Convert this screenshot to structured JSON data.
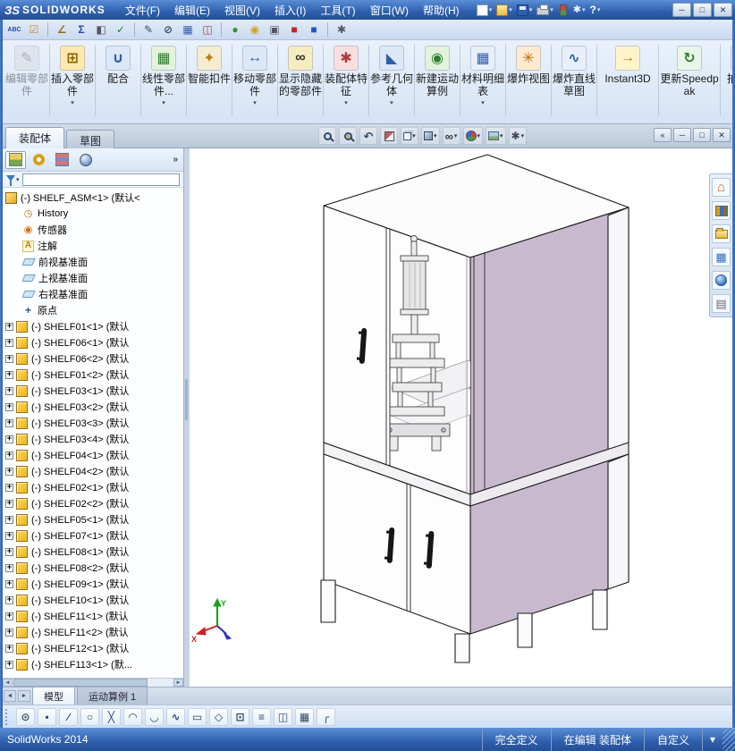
{
  "titlebar": {
    "logo_mark": "ЗS",
    "logo_text": "SOLIDWORKS",
    "menus": [
      "文件(F)",
      "编辑(E)",
      "视图(V)",
      "插入(I)",
      "工具(T)",
      "窗口(W)",
      "帮助(H)"
    ],
    "quick_access": [
      {
        "name": "new-document-button",
        "kind": "page",
        "arrow": true
      },
      {
        "name": "open-button",
        "kind": "folder",
        "arrow": true
      },
      {
        "name": "save-button",
        "kind": "disk",
        "arrow": true
      },
      {
        "name": "print-button",
        "kind": "printer",
        "arrow": true
      },
      {
        "name": "rebuild-button",
        "kind": "rebuild"
      },
      {
        "name": "options-button",
        "kind": "options",
        "arrow": true
      },
      {
        "name": "help-button",
        "kind": "help",
        "arrow": true
      }
    ],
    "window_buttons": [
      {
        "name": "minimize-button",
        "glyph": "─"
      },
      {
        "name": "maximize-button",
        "glyph": "□"
      },
      {
        "name": "close-button",
        "glyph": "✕"
      }
    ]
  },
  "toolbar2": {
    "items": [
      {
        "name": "spell-check-icon",
        "glyph": "ABC",
        "color": "#1f49b0"
      },
      {
        "name": "design-checker-icon",
        "glyph": "☑",
        "color": "#d88018"
      },
      {
        "name": "measure-icon",
        "glyph": "∠",
        "color": "#9a6a10",
        "sep": true
      },
      {
        "name": "mass-properties-icon",
        "glyph": "Σ",
        "color": "#1f49b0"
      },
      {
        "name": "section-properties-icon",
        "glyph": "◧",
        "color": "#555566"
      },
      {
        "name": "check-entity-icon",
        "glyph": "✓",
        "color": "#1a8a1a"
      },
      {
        "name": "sketch-entities-icon",
        "glyph": "✎",
        "color": "#334f6b",
        "sep": true
      },
      {
        "name": "dimension-icon",
        "glyph": "⊘",
        "color": "#334f6b"
      },
      {
        "name": "table-icon",
        "glyph": "▦",
        "color": "#2f5fae"
      },
      {
        "name": "interference-check-icon",
        "glyph": "◫",
        "color": "#b33a3a"
      },
      {
        "name": "appearance-swatch-icon",
        "glyph": "●",
        "color": "#2f8f2f",
        "sep": true
      },
      {
        "name": "lights-icon",
        "glyph": "◉",
        "color": "#d8a018"
      },
      {
        "name": "camera-icon",
        "glyph": "▣",
        "color": "#555566"
      },
      {
        "name": "red-swatch-icon",
        "glyph": "■",
        "color": "#cc2222"
      },
      {
        "name": "blue-swatch-icon",
        "glyph": "■",
        "color": "#2255cc"
      },
      {
        "name": "toolbar-options-icon",
        "glyph": "✱",
        "color": "#555566",
        "sep": true
      }
    ]
  },
  "ribbon": {
    "buttons": [
      {
        "name": "edit-component",
        "label": "编辑零部件",
        "glyph": "✎",
        "fg": "#777d86",
        "bg": "#d9dde3",
        "disabled": true
      },
      {
        "name": "insert-component",
        "label": "插入零部件",
        "glyph": "⊞",
        "fg": "#8a5c00",
        "bg": "#ffe9ae",
        "arrow": true
      },
      {
        "name": "mate",
        "label": "配合",
        "glyph": "∪",
        "fg": "#2f5fae",
        "bg": "#dce8f8"
      },
      {
        "name": "linear-component-pattern",
        "label": "线性零部件...",
        "glyph": "▦",
        "fg": "#2f7f2f",
        "bg": "#e2f2dc",
        "arrow": true
      },
      {
        "name": "smart-fasteners",
        "label": "智能扣件",
        "glyph": "✦",
        "fg": "#b8860b",
        "bg": "#f5ecd2"
      },
      {
        "name": "move-component",
        "label": "移动零部件",
        "glyph": "↔",
        "fg": "#2f5fae",
        "bg": "#dce8f8",
        "arrow": true
      },
      {
        "name": "show-hidden-components",
        "label": "显示隐藏的零部件",
        "glyph": "∞",
        "fg": "#333333",
        "bg": "#f7ecc0"
      },
      {
        "name": "assembly-features",
        "label": "装配体特征",
        "glyph": "✱",
        "fg": "#b03a3a",
        "bg": "#f8dfdf",
        "arrow": true
      },
      {
        "name": "reference-geometry",
        "label": "参考几何体",
        "glyph": "◣",
        "fg": "#2f5fae",
        "bg": "#dce8f8",
        "arrow": true
      },
      {
        "name": "new-motion-study",
        "label": "新建运动算例",
        "glyph": "◉",
        "fg": "#2f7f2f",
        "bg": "#e2f2dc"
      },
      {
        "name": "bill-of-materials",
        "label": "材料明细表",
        "glyph": "▦",
        "fg": "#2f5fae",
        "bg": "#e8eff8",
        "arrow": true
      },
      {
        "name": "exploded-view",
        "label": "爆炸视图",
        "glyph": "✳",
        "fg": "#c06a10",
        "bg": "#ffe9cf"
      },
      {
        "name": "explode-line-sketch",
        "label": "爆炸直线草图",
        "glyph": "∿",
        "fg": "#2f5fae",
        "bg": "#e8eff8"
      },
      {
        "name": "instant3d",
        "label": "Instant3D",
        "glyph": "→",
        "fg": "#c08a00",
        "bg": "#fff3cc",
        "wide": true
      },
      {
        "name": "update-speedpak",
        "label": "更新Speedpak",
        "glyph": "↻",
        "fg": "#2f7f2f",
        "bg": "#e8f5e8",
        "wide": true
      },
      {
        "name": "take-snapshot",
        "label": "拍快照",
        "glyph": "⊙",
        "fg": "#555555",
        "bg": "#e8e8ea"
      }
    ]
  },
  "command_tabs": [
    {
      "label": "装配体",
      "active": true
    },
    {
      "label": "草图",
      "active": false
    }
  ],
  "headsup": [
    {
      "name": "zoom-fit-icon",
      "kind": "mag"
    },
    {
      "name": "zoom-to-area-icon",
      "kind": "mag2"
    },
    {
      "name": "previous-view-icon",
      "kind": "undo"
    },
    {
      "name": "section-view-icon",
      "kind": "section"
    },
    {
      "name": "view-orientation-icon",
      "kind": "cube",
      "arrow": true
    },
    {
      "name": "display-style-icon",
      "kind": "shaded",
      "arrow": true
    },
    {
      "name": "hide-show-items-icon",
      "kind": "glasses",
      "arrow": true
    },
    {
      "name": "edit-appearance-icon",
      "kind": "ball",
      "arrow": true
    },
    {
      "name": "apply-scene-icon",
      "kind": "scene",
      "arrow": true
    },
    {
      "name": "view-settings-icon",
      "kind": "gear",
      "arrow": true
    }
  ],
  "doc_controls": [
    {
      "name": "dock-panel-button",
      "glyph": "«"
    },
    {
      "name": "minimize-document-button",
      "glyph": "─"
    },
    {
      "name": "restore-document-button",
      "glyph": "□"
    },
    {
      "name": "close-document-button",
      "glyph": "✕"
    }
  ],
  "feature_panel": {
    "manager_tabs": [
      {
        "name": "feature-manager-tab",
        "kind": "fm"
      },
      {
        "name": "property-manager-tab",
        "kind": "pm"
      },
      {
        "name": "configuration-manager-tab",
        "kind": "cm"
      },
      {
        "name": "display-manager-tab",
        "kind": "dm"
      }
    ],
    "expand_glyph": "»",
    "filter_arrow": "▾",
    "filter": {
      "value": ""
    },
    "scrollbar": {
      "left": "◄",
      "right": "►"
    },
    "tree": {
      "root": {
        "label": "(-) SHELF_ASM<1> (默认<"
      },
      "folders": [
        {
          "kind": "history",
          "label": "History"
        },
        {
          "kind": "sensor",
          "label": "传感器"
        },
        {
          "kind": "annotation",
          "label": "注解"
        },
        {
          "kind": "plane",
          "label": "前视基准面"
        },
        {
          "kind": "plane",
          "label": "上视基准面"
        },
        {
          "kind": "plane",
          "label": "右视基准面"
        },
        {
          "kind": "origin",
          "label": "原点"
        }
      ],
      "components": [
        "(-) SHELF01<1> (默认",
        "(-) SHELF06<1> (默认",
        "(-) SHELF06<2> (默认",
        "(-) SHELF01<2> (默认",
        "(-) SHELF03<1> (默认",
        "(-) SHELF03<2> (默认",
        "(-) SHELF03<3> (默认",
        "(-) SHELF03<4> (默认",
        "(-) SHELF04<1> (默认",
        "(-) SHELF04<2> (默认",
        "(-) SHELF02<1> (默认",
        "(-) SHELF02<2> (默认",
        "(-) SHELF05<1> (默认",
        "(-) SHELF07<1> (默认",
        "(-) SHELF08<1> (默认",
        "(-) SHELF08<2> (默认",
        "(-) SHELF09<1> (默认",
        "(-) SHELF10<1> (默认",
        "(-) SHELF11<1> (默认",
        "(-) SHELF11<2> (默认",
        "(-) SHELF12<1> (默认",
        "(-) SHELF113<1> (默..."
      ]
    }
  },
  "task_pane": [
    {
      "name": "task-pane-resources-tab",
      "kind": "home"
    },
    {
      "name": "design-library-tab",
      "kind": "books"
    },
    {
      "name": "file-explorer-tab",
      "kind": "folder"
    },
    {
      "name": "view-palette-tab",
      "kind": "palette"
    },
    {
      "name": "appearances-tab",
      "kind": "sphere"
    },
    {
      "name": "custom-properties-tab",
      "kind": "doc"
    }
  ],
  "doc_tabs": {
    "nav": [
      {
        "name": "tab-scroll-left-button",
        "glyph": "◄"
      },
      {
        "name": "tab-scroll-right-button",
        "glyph": "►"
      }
    ],
    "tabs": [
      {
        "label": "模型",
        "active": true
      },
      {
        "label": "运动算例 1",
        "active": false
      }
    ]
  },
  "sketch_toolbar": {
    "items": [
      {
        "name": "smart-dimension-icon",
        "glyph": "⊙"
      },
      {
        "name": "point-icon",
        "glyph": "•"
      },
      {
        "name": "line-icon",
        "glyph": "∕"
      },
      {
        "name": "circle-icon",
        "glyph": "○"
      },
      {
        "name": "trim-icon",
        "glyph": "╳"
      },
      {
        "name": "arc-icon",
        "glyph": "◠"
      },
      {
        "name": "tangent-arc-icon",
        "glyph": "◡"
      },
      {
        "name": "spline-icon",
        "glyph": "∿"
      },
      {
        "name": "rectangle-icon",
        "glyph": "▭"
      },
      {
        "name": "polygon-icon",
        "glyph": "◇"
      },
      {
        "name": "convert-entities-icon",
        "glyph": "⊡"
      },
      {
        "name": "offset-entities-icon",
        "glyph": "≡"
      },
      {
        "name": "mirror-entities-icon",
        "glyph": "◫"
      },
      {
        "name": "linear-sketch-pattern-icon",
        "glyph": "▦"
      },
      {
        "name": "sketch-fillet-icon",
        "glyph": "╭"
      }
    ]
  },
  "status_bar": {
    "app": "SolidWorks 2014",
    "segments": [
      "完全定义",
      "在编辑 装配体",
      "自定义"
    ],
    "dropdown_glyph": "▾"
  },
  "model": {
    "colors": {
      "side_panel": "#c9b9ce",
      "faces": "#ffffff",
      "edges": "#1c1c1c",
      "triad_x": "#cc2222",
      "triad_y": "#18a018",
      "triad_z": "#2233cc"
    }
  }
}
